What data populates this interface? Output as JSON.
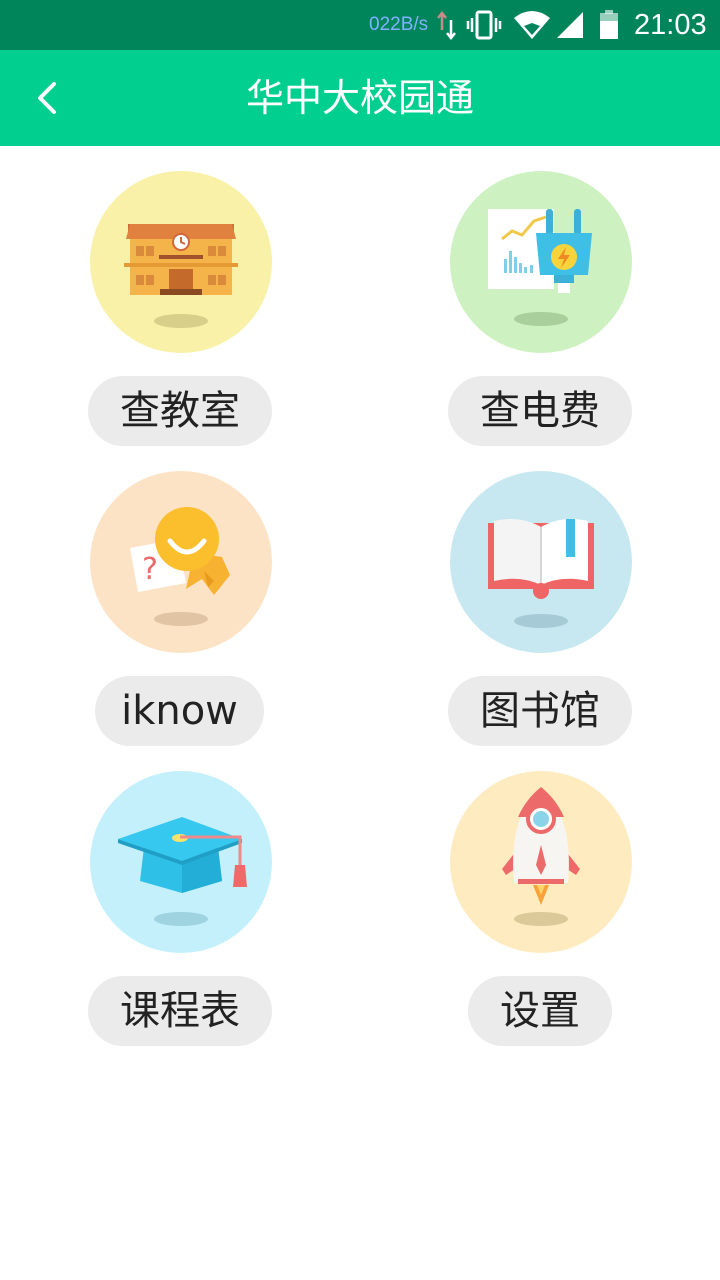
{
  "status_bar": {
    "net_speed": "022B/s",
    "time": "21:03"
  },
  "app_bar": {
    "title": "华中大校园通",
    "back_icon": "chevron-left-icon"
  },
  "menu": [
    {
      "label": "查教室",
      "icon": "classroom-building-icon",
      "bg": "#F9F1A8"
    },
    {
      "label": "查电费",
      "icon": "electric-plug-icon",
      "bg": "#CEF1C2"
    },
    {
      "label": "iknow",
      "icon": "question-badge-icon",
      "bg": "#FDE3C5"
    },
    {
      "label": "图书馆",
      "icon": "open-book-icon",
      "bg": "#C8E8F1"
    },
    {
      "label": "课程表",
      "icon": "graduation-cap-icon",
      "bg": "#C4F0FC"
    },
    {
      "label": "设置",
      "icon": "rocket-icon",
      "bg": "#FEECC0"
    }
  ]
}
